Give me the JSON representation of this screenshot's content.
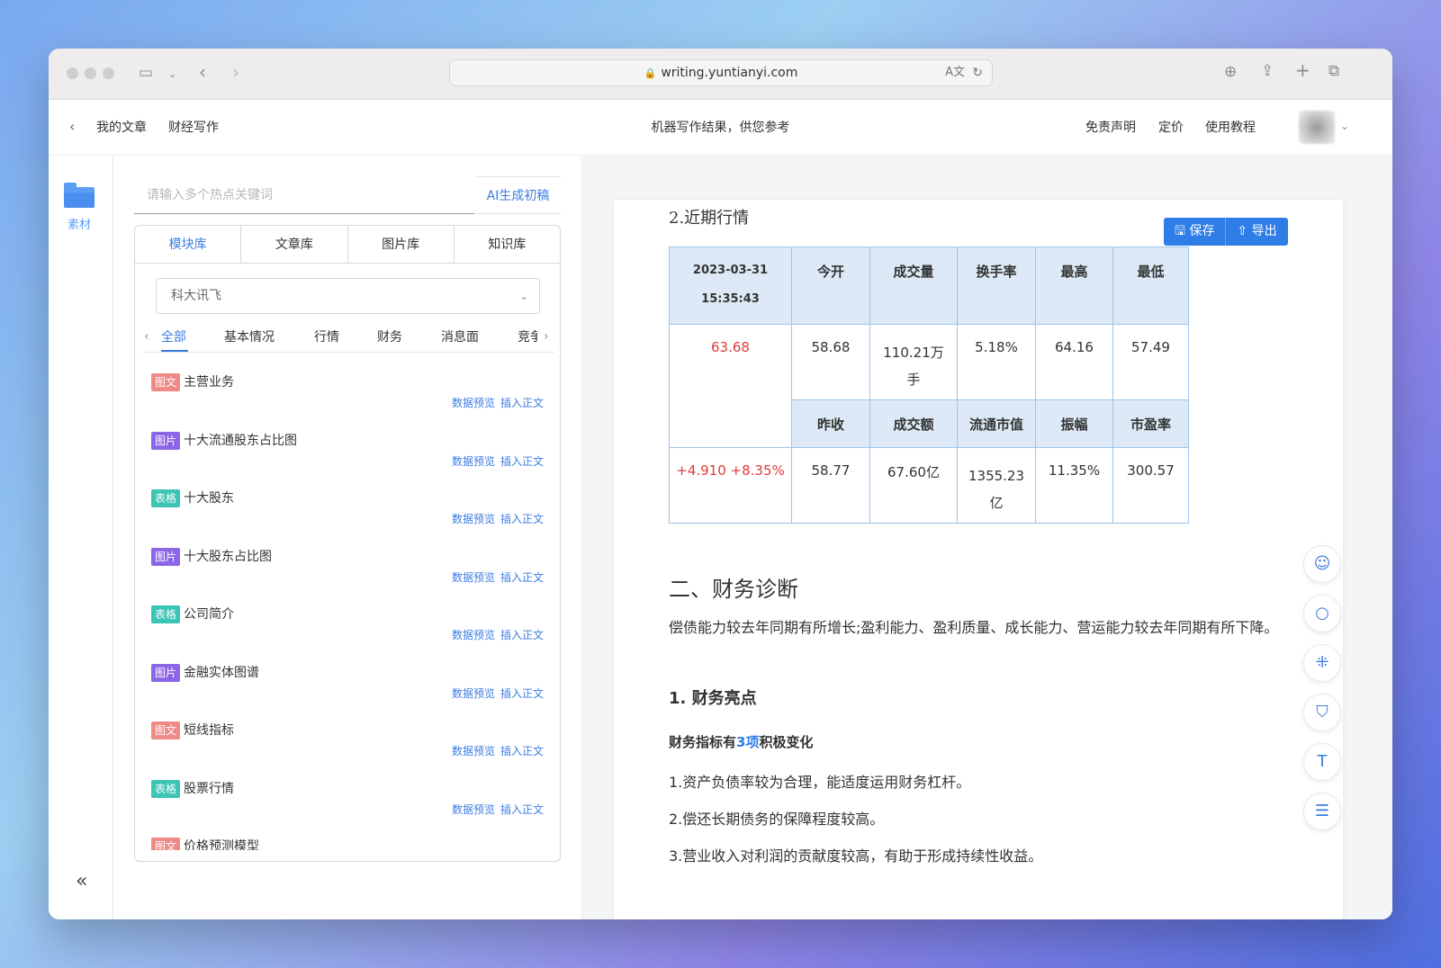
{
  "browser": {
    "url": "writing.yuntianyi.com",
    "translate_glyph": "A文",
    "reload_glyph": "↻"
  },
  "header": {
    "back": "‹",
    "crumbs": [
      "我的文章",
      "财经写作"
    ],
    "notice": "机器写作结果，供您参考",
    "links": [
      "免责声明",
      "定价",
      "使用教程"
    ]
  },
  "rail": {
    "material_label": "素材",
    "collapse_glyph": "«"
  },
  "panel": {
    "keyword_placeholder": "请输入多个热点关键词",
    "ai_button": "AI生成初稿",
    "lib_tabs": [
      "模块库",
      "文章库",
      "图片库",
      "知识库"
    ],
    "stock_select": "科大讯飞",
    "categories": [
      "全部",
      "基本情况",
      "行情",
      "财务",
      "消息面",
      "竞争"
    ],
    "items": [
      {
        "badge": "图文",
        "type": "tw",
        "title": "主营业务"
      },
      {
        "badge": "图片",
        "type": "tp",
        "title": "十大流通股东占比图"
      },
      {
        "badge": "表格",
        "type": "bg",
        "title": "十大股东"
      },
      {
        "badge": "图片",
        "type": "tp",
        "title": "十大股东占比图"
      },
      {
        "badge": "表格",
        "type": "bg",
        "title": "公司简介"
      },
      {
        "badge": "图片",
        "type": "tp",
        "title": "金融实体图谱"
      },
      {
        "badge": "图文",
        "type": "tw",
        "title": "短线指标"
      },
      {
        "badge": "表格",
        "type": "bg",
        "title": "股票行情"
      },
      {
        "badge": "图文",
        "type": "tw",
        "title": "价格预测模型"
      }
    ],
    "preview_label": "数据预览",
    "insert_label": "插入正文"
  },
  "doc": {
    "save": "保存",
    "export": "导出",
    "section_title": "2.近期行情",
    "table": {
      "date": "2023-03-31",
      "time": "15:35:43",
      "headers1": [
        "今开",
        "成交量",
        "换手率",
        "最高",
        "最低"
      ],
      "price": "63.68",
      "values1": [
        "58.68",
        "110.21万手",
        "5.18%",
        "64.16",
        "57.49"
      ],
      "headers2": [
        "昨收",
        "成交额",
        "流通市值",
        "振幅",
        "市盈率"
      ],
      "change": "+4.910 +8.35%",
      "values2": [
        "58.77",
        "67.60亿",
        "1355.23亿",
        "11.35%",
        "300.57"
      ]
    },
    "h2": "二、财务诊断",
    "para": "偿债能力较去年同期有所增长;盈利能力、盈利质量、成长能力、营运能力较去年同期有所下降。",
    "h3": "1. 财务亮点",
    "highlight_prefix": "财务指标有",
    "highlight_num": "3项",
    "highlight_suffix": "积极变化",
    "points": [
      "1.资产负债率较为合理，能适度运用财务杠杆。",
      "2.偿还长期债务的保障程度较高。",
      "3.营业收入对利润的贡献度较高，有助于形成持续性收益。"
    ]
  },
  "colors": {
    "accent": "#2f7de6",
    "up": "#e03a3a",
    "table_header": "#dde9f7"
  }
}
